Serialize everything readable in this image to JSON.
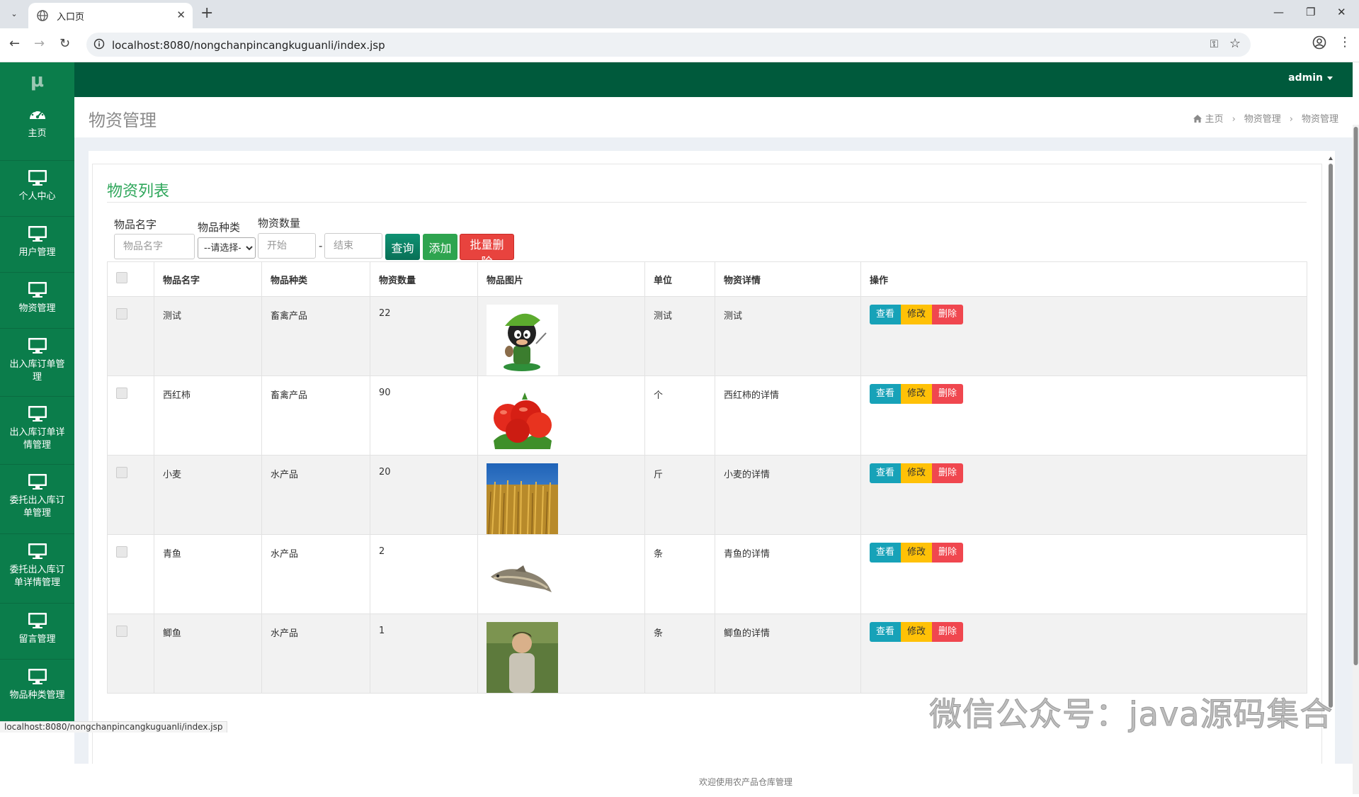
{
  "browser": {
    "tab_title": "入口页",
    "url": "localhost:8080/nongchanpincangkuguanli/index.jsp",
    "status_url": "localhost:8080/nongchanpincangkuguanli/index.jsp"
  },
  "app": {
    "brand": "μ",
    "user": "admin",
    "footer": "欢迎使用农产品仓库管理"
  },
  "sidebar": {
    "items": [
      {
        "label": "主页",
        "icon": "dashboard-icon"
      },
      {
        "label": "个人中心",
        "icon": "monitor-icon"
      },
      {
        "label": "用户管理",
        "icon": "monitor-icon"
      },
      {
        "label": "物资管理",
        "icon": "monitor-icon"
      },
      {
        "label": "出入库订单管理",
        "icon": "monitor-icon"
      },
      {
        "label": "出入库订单详情管理",
        "icon": "monitor-icon"
      },
      {
        "label": "委托出入库订单管理",
        "icon": "monitor-icon"
      },
      {
        "label": "委托出入库订单详情管理",
        "icon": "monitor-icon"
      },
      {
        "label": "留言管理",
        "icon": "monitor-icon"
      },
      {
        "label": "物品种类管理",
        "icon": "monitor-icon"
      }
    ]
  },
  "header": {
    "title": "物资管理",
    "breadcrumb": [
      "主页",
      "物资管理",
      "物资管理"
    ]
  },
  "list": {
    "title": "物资列表",
    "filters": {
      "name_label": "物品名字",
      "name_placeholder": "物品名字",
      "type_label": "物品种类",
      "type_selected": "--请选择--",
      "qty_label": "物资数量",
      "qty_from_placeholder": "开始",
      "qty_dash": "-",
      "qty_to_placeholder": "结束"
    },
    "buttons": {
      "query": "查询",
      "add": "添加",
      "batch_delete": "批量删除"
    },
    "columns": [
      "物品名字",
      "物品种类",
      "物资数量",
      "物品图片",
      "单位",
      "物资详情",
      "操作"
    ],
    "actions": {
      "view": "查看",
      "edit": "修改",
      "delete": "删除"
    },
    "rows": [
      {
        "name": "测试",
        "type": "畜禽产品",
        "qty": "22",
        "image": "cartoon-character",
        "unit": "测试",
        "detail": "测试"
      },
      {
        "name": "西红柿",
        "type": "畜禽产品",
        "qty": "90",
        "image": "tomatoes",
        "unit": "个",
        "detail": "西红柿的详情"
      },
      {
        "name": "小麦",
        "type": "水产品",
        "qty": "20",
        "image": "wheat-field",
        "unit": "斤",
        "detail": "小麦的详情"
      },
      {
        "name": "青鱼",
        "type": "水产品",
        "qty": "2",
        "image": "fish",
        "unit": "条",
        "detail": "青鱼的详情"
      },
      {
        "name": "鲫鱼",
        "type": "水产品",
        "qty": "1",
        "image": "person-photo",
        "unit": "条",
        "detail": "鲫鱼的详情"
      }
    ]
  },
  "watermark": "微信公众号：java源码集合",
  "colors": {
    "sidebar": "#0b7d4b",
    "topnav": "#005a3c",
    "title_green": "#2fa75b",
    "view": "#17a2b8",
    "edit": "#ffc107",
    "delete": "#f0474f"
  }
}
